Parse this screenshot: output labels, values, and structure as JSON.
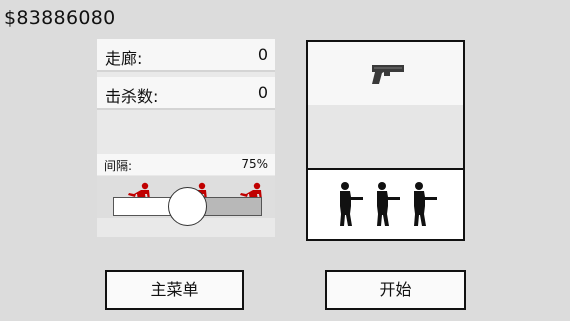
{
  "money": "$83886080",
  "stats": {
    "corridor_label": "走廊:",
    "corridor_value": "0",
    "kills_label": "击杀数:",
    "kills_value": "0",
    "interval_label": "间隔:",
    "interval_value": "75%"
  },
  "interval_slider": {
    "level": 0.5
  },
  "enemy_color": "#c00000",
  "shooter_color": "#111111",
  "weapon_icon": "pistol-icon",
  "buttons": {
    "menu_label": "主菜单",
    "start_label": "开始"
  }
}
